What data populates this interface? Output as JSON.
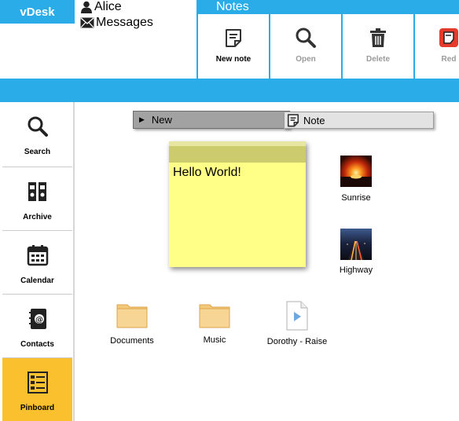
{
  "app": {
    "brand": "vDesk"
  },
  "user": {
    "name": "Alice",
    "messages_label": "Messages"
  },
  "ribbon": {
    "title": "Notes",
    "buttons": [
      {
        "label": "New note",
        "icon": "note-icon",
        "enabled": true
      },
      {
        "label": "Open",
        "icon": "magnifier-icon",
        "enabled": false
      },
      {
        "label": "Delete",
        "icon": "trash-icon",
        "enabled": false
      },
      {
        "label": "Red",
        "icon": "red-note-icon",
        "enabled": false
      }
    ]
  },
  "sidebar": {
    "items": [
      {
        "label": "Search",
        "icon": "search-icon"
      },
      {
        "label": "Archive",
        "icon": "binders-icon"
      },
      {
        "label": "Calendar",
        "icon": "calendar-icon"
      },
      {
        "label": "Contacts",
        "icon": "address-book-icon"
      },
      {
        "label": "Pinboard",
        "icon": "pinboard-icon",
        "active": true
      }
    ]
  },
  "context_menu": {
    "new_label": "New",
    "note_label": "Note"
  },
  "sticky_note": {
    "text": "Hello World!",
    "color": "#ffff88"
  },
  "desktop": {
    "images": [
      {
        "label": "Sunrise"
      },
      {
        "label": "Highway"
      }
    ],
    "folders": [
      {
        "label": "Documents"
      },
      {
        "label": "Music"
      }
    ],
    "files": [
      {
        "label": "Dorothy - Raise"
      }
    ]
  },
  "colors": {
    "accent": "#29ace8",
    "active": "#fbc02d"
  }
}
